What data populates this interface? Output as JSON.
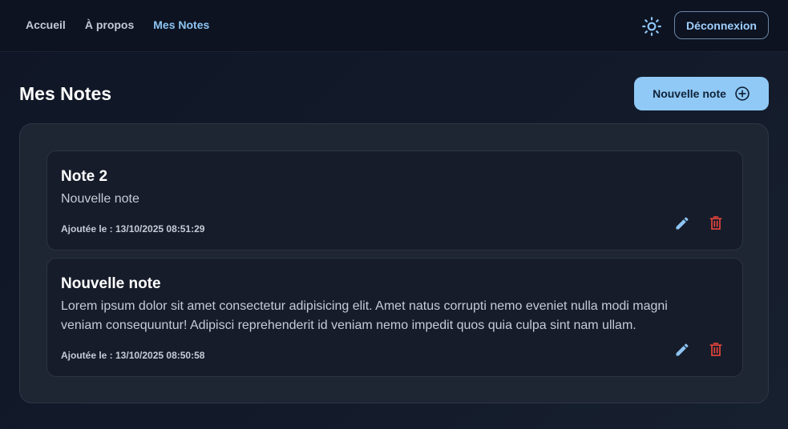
{
  "nav": {
    "items": [
      {
        "label": "Accueil",
        "active": false
      },
      {
        "label": "À propos",
        "active": false
      },
      {
        "label": "Mes Notes",
        "active": true
      }
    ],
    "theme_icon": "sun-icon",
    "logout_label": "Déconnexion"
  },
  "main": {
    "title": "Mes Notes",
    "new_note_label": "Nouvelle note",
    "new_note_icon": "plus-circle-icon"
  },
  "notes": [
    {
      "title": "Note 2",
      "body": "Nouvelle note",
      "date": "Ajoutée le : 13/10/2025 08:51:29",
      "edit_icon": "pencil-icon",
      "delete_icon": "trash-icon"
    },
    {
      "title": "Nouvelle note",
      "body": "Lorem ipsum dolor sit amet consectetur adipisicing elit. Amet natus corrupti nemo eveniet nulla modi magni veniam consequuntur! Adipisci reprehenderit id veniam nemo impedit quos quia culpa sint nam ullam.",
      "date": "Ajoutée le : 13/10/2025 08:50:58",
      "edit_icon": "pencil-icon",
      "delete_icon": "trash-icon"
    }
  ],
  "colors": {
    "accent": "#8ec5f3",
    "primary_button": "#90c9f6",
    "edit_icon": "#8ec5f3",
    "delete_icon": "#e8453c"
  }
}
